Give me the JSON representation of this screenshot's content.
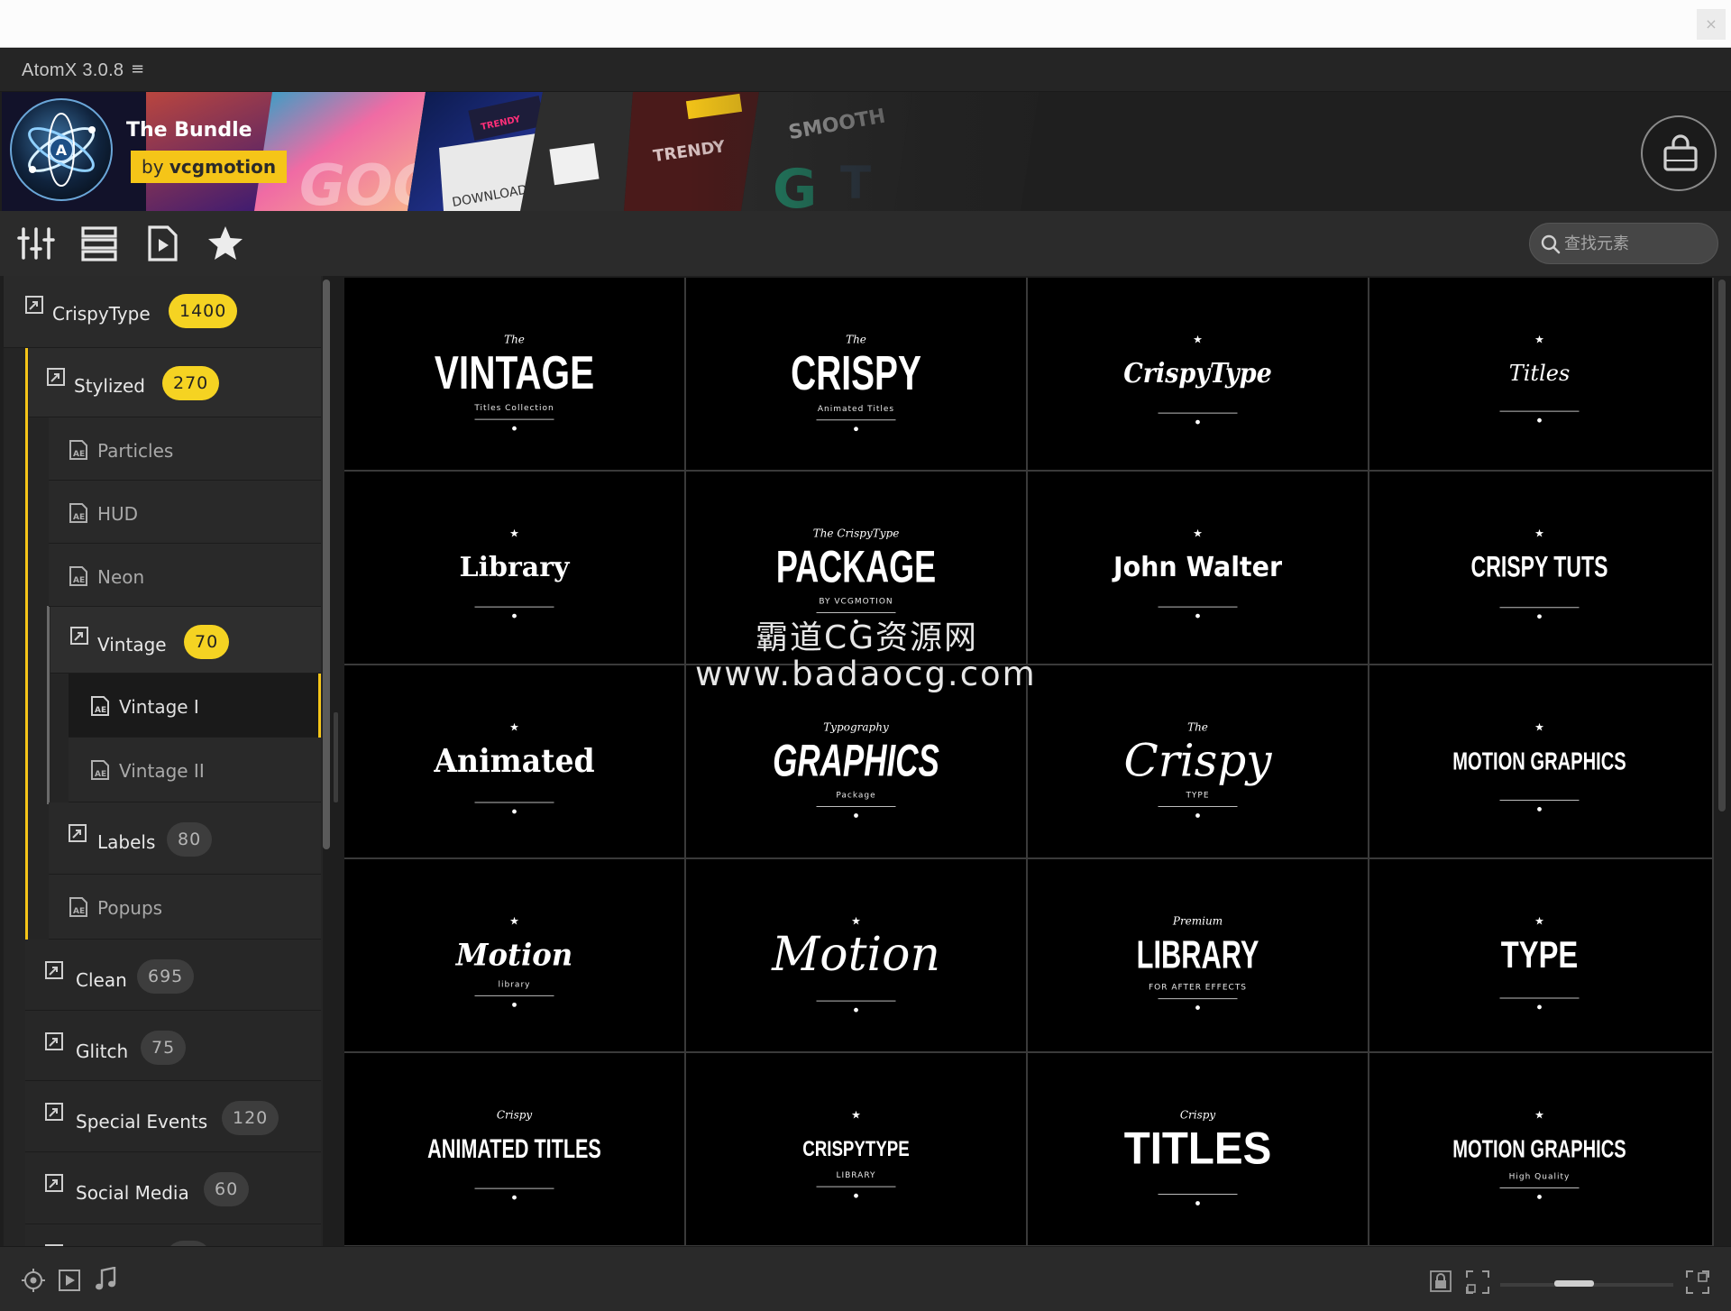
{
  "os": {
    "close_glyph": "×"
  },
  "app": {
    "title": "AtomX 3.0.8",
    "menu_glyph": "≡"
  },
  "banner": {
    "title": "The Bundle",
    "by_prefix": "by",
    "by_name": "vcgmotion",
    "art_words": [
      "TRENDY",
      "DOWNLOAD",
      "TRENDY",
      "SMOOTH",
      "GOOD"
    ]
  },
  "toolbar": {
    "icons": [
      "sliders-icon",
      "list-icon",
      "video-file-icon",
      "star-icon"
    ],
    "search_placeholder": "查找元素"
  },
  "sidebar": {
    "crispytype": {
      "label": "CrispyType",
      "count": "1400"
    },
    "stylized": {
      "label": "Stylized",
      "count": "270"
    },
    "particles": {
      "label": "Particles"
    },
    "hud": {
      "label": "HUD"
    },
    "neon": {
      "label": "Neon"
    },
    "vintage": {
      "label": "Vintage",
      "count": "70"
    },
    "vintage_1": {
      "label": "Vintage I"
    },
    "vintage_2": {
      "label": "Vintage II"
    },
    "labels": {
      "label": "Labels",
      "count": "80"
    },
    "popups": {
      "label": "Popups"
    },
    "clean": {
      "label": "Clean",
      "count": "695"
    },
    "glitch": {
      "label": "Glitch",
      "count": "75"
    },
    "special_events": {
      "label": "Special Events",
      "count": "120"
    },
    "social_media": {
      "label": "Social Media",
      "count": "60"
    }
  },
  "grid": {
    "tiles": [
      {
        "title": "VINTAGE",
        "top": "The",
        "sub": "Titles Collection"
      },
      {
        "title": "CRISPY",
        "top": "The",
        "sub": "Animated Titles"
      },
      {
        "title": "CrispyType",
        "top": "",
        "sub": ""
      },
      {
        "title": "Titles",
        "top": "",
        "sub": ""
      },
      {
        "title": "Library",
        "top": "",
        "sub": ""
      },
      {
        "title": "PACKAGE",
        "top": "The CrispyType",
        "sub": "BY VCGMOTION"
      },
      {
        "title": "John Walter",
        "top": "",
        "sub": ""
      },
      {
        "title": "CRISPY TUTS",
        "top": "",
        "sub": ""
      },
      {
        "title": "Animated",
        "top": "",
        "sub": ""
      },
      {
        "title": "GRAPHICS",
        "top": "Typography",
        "sub": "Package"
      },
      {
        "title": "Crispy",
        "top": "The",
        "sub": "TYPE"
      },
      {
        "title": "MOTION GRAPHICS",
        "top": "",
        "sub": ""
      },
      {
        "title": "Motion",
        "top": "",
        "sub": "library"
      },
      {
        "title": "Motion",
        "top": "",
        "sub": ""
      },
      {
        "title": "LIBRARY",
        "top": "Premium",
        "sub": "FOR AFTER EFFECTS"
      },
      {
        "title": "TYPE",
        "top": "",
        "sub": ""
      },
      {
        "title": "ANIMATED TITLES",
        "top": "Crispy",
        "sub": ""
      },
      {
        "title": "CRISPYTYPE",
        "top": "",
        "sub": "LIBRARY"
      },
      {
        "title": "TITLES",
        "top": "Crispy",
        "sub": ""
      },
      {
        "title": "MOTION GRAPHICS",
        "top": "",
        "sub": "High Quality"
      }
    ]
  },
  "watermark": {
    "line1": "霸道CG资源网",
    "line2": "www.badaocg.com"
  },
  "bottombar": {
    "left_icons": [
      "preview-target-icon",
      "video-icon",
      "music-note-icon"
    ],
    "right_icons": [
      "lock-icon",
      "expand-icon",
      "fit-icon"
    ],
    "zoom_level": 0.35
  },
  "colors": {
    "accent": "#f5c518",
    "panel": "#252525",
    "tile": "#000000"
  }
}
